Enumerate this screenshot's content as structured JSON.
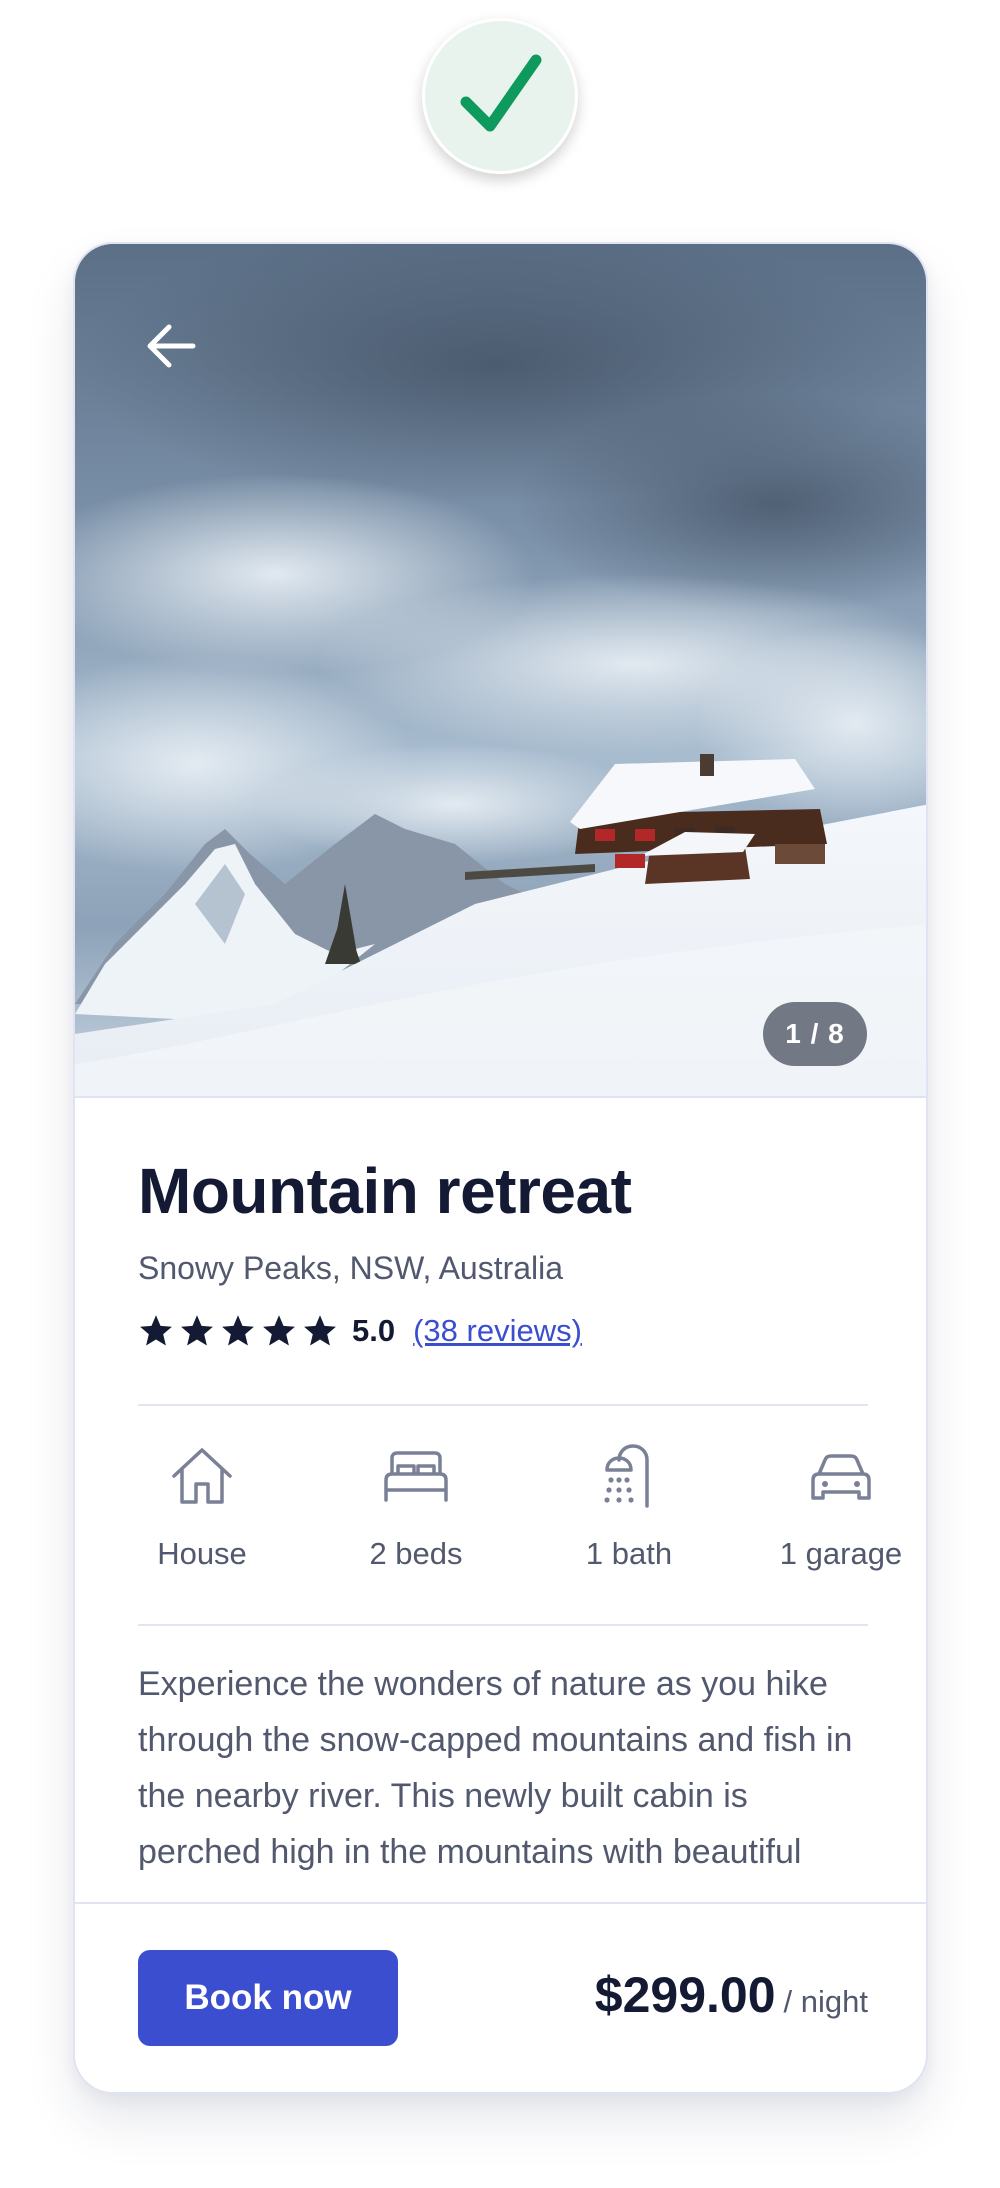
{
  "status": {
    "icon": "checkmark-icon",
    "color": "#0e9a5c"
  },
  "listing": {
    "back_icon": "arrow-left-icon",
    "photo_counter": "1 / 8",
    "title": "Mountain retreat",
    "location": "Snowy Peaks, NSW, Australia",
    "rating": {
      "stars": 5,
      "score": "5.0",
      "reviews_label": "(38 reviews)"
    },
    "amenities": [
      {
        "icon": "house-icon",
        "label": "House"
      },
      {
        "icon": "bed-icon",
        "label": "2 beds"
      },
      {
        "icon": "shower-icon",
        "label": "1 bath"
      },
      {
        "icon": "car-icon",
        "label": "1 garage"
      }
    ],
    "description": "Experience the wonders of nature as you hike through the snow-capped mountains and fish in the nearby river. This newly built cabin is perched high in the mountains with beautiful"
  },
  "footer": {
    "book_label": "Book now",
    "price": "$299.00",
    "price_unit": "/ night"
  },
  "colors": {
    "accent": "#3b4ed0",
    "text_primary": "#141a33",
    "text_secondary": "#52586e",
    "success": "#0e9a5c"
  }
}
